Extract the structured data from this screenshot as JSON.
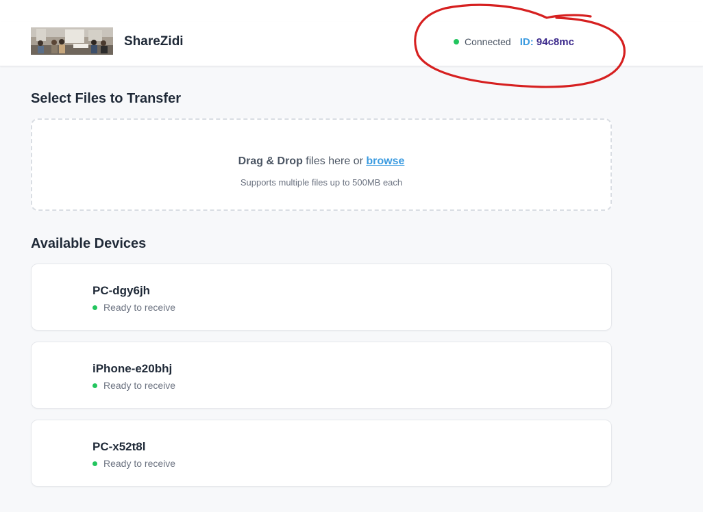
{
  "header": {
    "app_name": "ShareZidi",
    "connection_status": "Connected",
    "id_prefix": "ID:",
    "id_value": "94c8mc",
    "status_color": "#22c55e"
  },
  "upload": {
    "title": "Select Files to Transfer",
    "drop_strong": "Drag & Drop",
    "drop_text": " files here or ",
    "browse_label": "browse",
    "hint": "Supports multiple files up to 500MB each"
  },
  "devices": {
    "title": "Available Devices",
    "items": [
      {
        "name": "PC-dgy6jh",
        "status": "Ready to receive"
      },
      {
        "name": "iPhone-e20bhj",
        "status": "Ready to receive"
      },
      {
        "name": "PC-x52t8l",
        "status": "Ready to receive"
      }
    ]
  },
  "colors": {
    "accent": "#3b9be0",
    "annotation": "#d62020"
  }
}
